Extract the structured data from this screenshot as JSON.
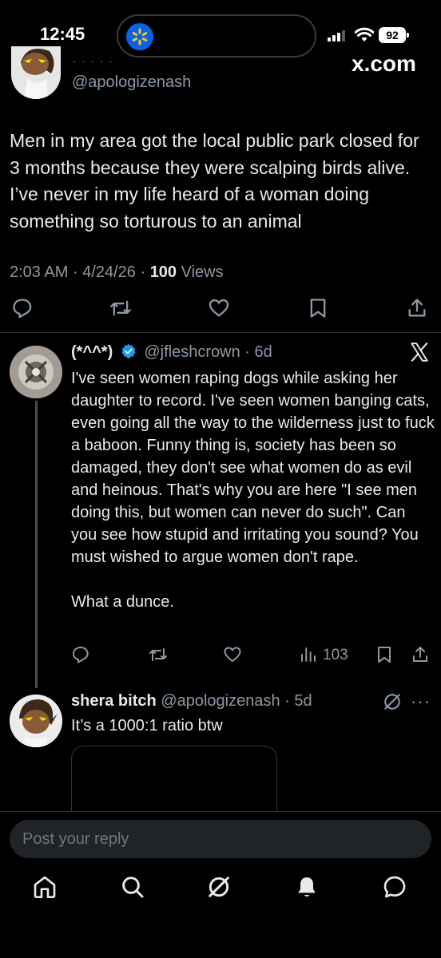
{
  "status_bar": {
    "time": "12:45",
    "battery": "92"
  },
  "browser": {
    "site_label": "x.com"
  },
  "post": {
    "handle": "@apologizenash",
    "text": "Men in my area got the local public park closed for 3 months because they were scalping birds alive. I’ve never in my life heard of a woman doing something so torturous to an animal",
    "time": "2:03 AM",
    "date": "4/24/26",
    "views_count": "100",
    "views_label": "Views"
  },
  "reply1": {
    "name": "(*^^*)",
    "handle": "@jfleshcrown",
    "age": "6d",
    "text": "I've seen women raping dogs while asking her daughter to record. I've seen women banging cats, even going all the way to the wilderness just to fuck a baboon. Funny thing is, society has been so damaged, they don't see what women do as evil and heinous. That's why you are here \"I see men doing this, but women can never do such\". Can you see how stupid and irritating you sound? You must wished to argue women don't rape.\n\nWhat a dunce.",
    "views": "103"
  },
  "reply2": {
    "name": "shera bitch",
    "handle": "@apologizenash",
    "age": "5d",
    "text": "It’s a 1000:1 ratio btw"
  },
  "composer": {
    "placeholder": "Post your reply"
  },
  "colors": {
    "background": "#000000",
    "text": "#e7e9ea",
    "muted": "#8b98a5",
    "verified": "#1d9bf0",
    "walmart_blue": "#0a63e6"
  }
}
